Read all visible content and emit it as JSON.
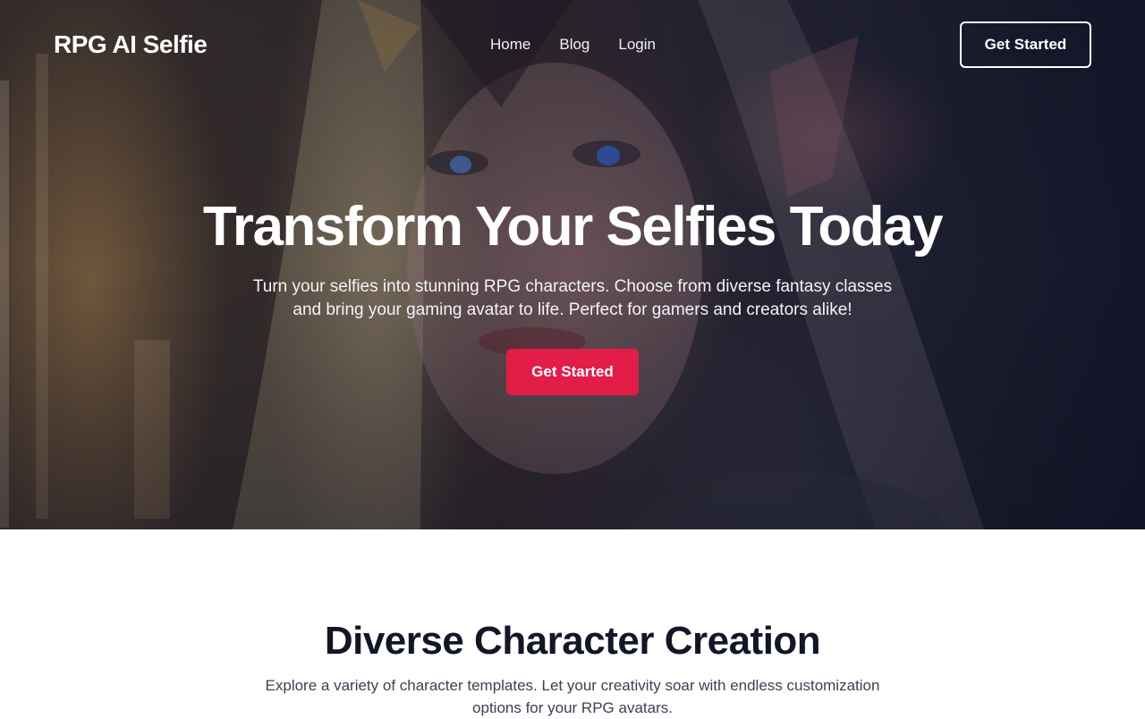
{
  "brand": {
    "name": "RPG AI Selfie"
  },
  "nav": {
    "links": [
      "Home",
      "Blog",
      "Login"
    ],
    "cta_label": "Get Started"
  },
  "hero": {
    "title": "Transform Your Selfies Today",
    "subtitle": "Turn your selfies into stunning RPG characters. Choose from diverse fantasy classes and bring your gaming avatar to life. Perfect for gamers and creators alike!",
    "cta_label": "Get Started"
  },
  "features": {
    "title": "Diverse Character Creation",
    "subtitle": "Explore a variety of character templates. Let your creativity soar with endless customization options for your RPG avatars."
  },
  "colors": {
    "accent": "#e11d48",
    "heading": "#131628",
    "body_text": "#3c4152"
  }
}
